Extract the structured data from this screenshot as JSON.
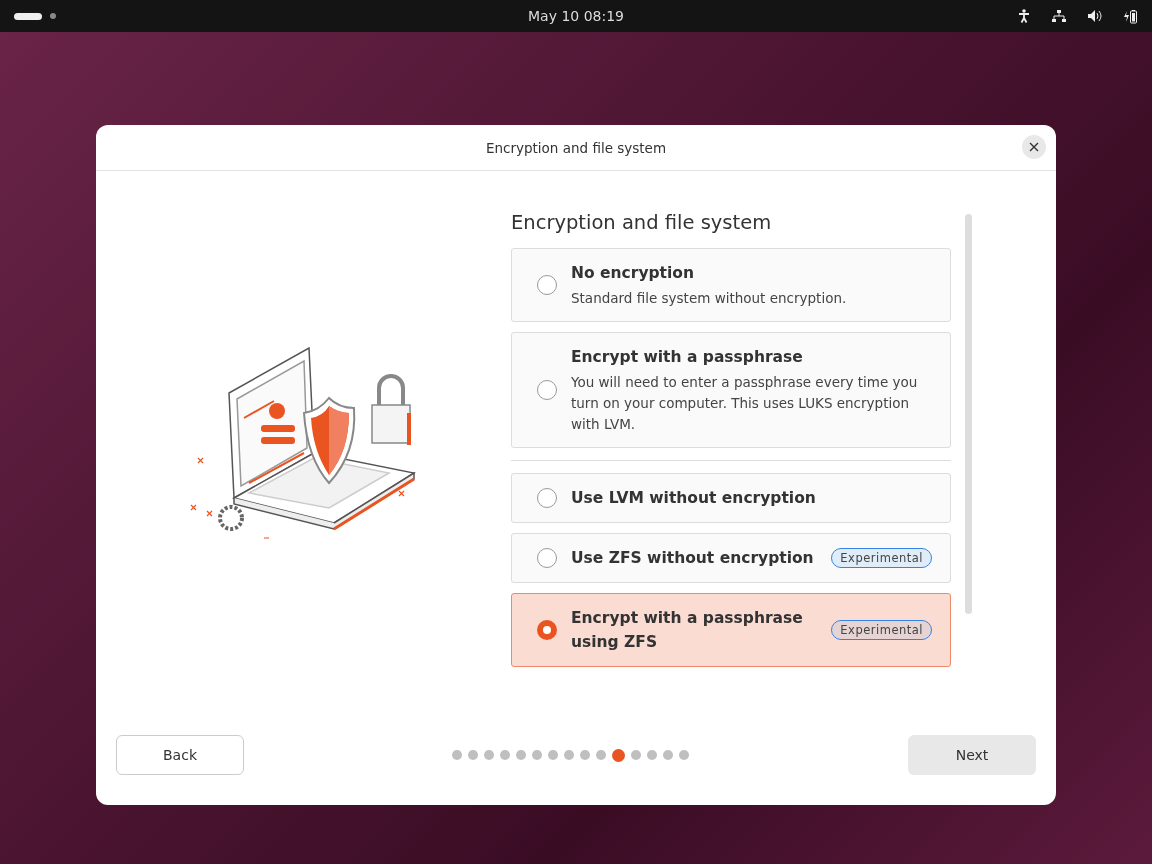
{
  "top_bar": {
    "clock": "May 10  08:19"
  },
  "dialog": {
    "title": "Encryption and file system",
    "heading": "Encryption and file system",
    "option_groups": [
      [
        {
          "title": "No encryption",
          "description": "Standard file system without encryption.",
          "selected": false
        },
        {
          "title": "Encrypt with a passphrase",
          "description": "You will need to enter a passphrase every time you turn on your computer. This uses LUKS encryption with LVM.",
          "selected": false
        }
      ],
      [
        {
          "title": "Use LVM without encryption",
          "selected": false
        },
        {
          "title": "Use ZFS without encryption",
          "badge": "Experimental",
          "selected": false
        },
        {
          "title": "Encrypt with a passphrase using ZFS",
          "badge": "Experimental",
          "selected": true
        }
      ]
    ],
    "back_button": "Back",
    "next_button": "Next",
    "pages": [
      {
        "selected": false
      },
      {
        "selected": false
      },
      {
        "selected": false
      },
      {
        "selected": false
      },
      {
        "selected": false
      },
      {
        "selected": false
      },
      {
        "selected": false
      },
      {
        "selected": false
      },
      {
        "selected": false
      },
      {
        "selected": false
      },
      {
        "selected": true
      },
      {
        "selected": false
      },
      {
        "selected": false
      },
      {
        "selected": false
      },
      {
        "selected": false
      }
    ]
  }
}
